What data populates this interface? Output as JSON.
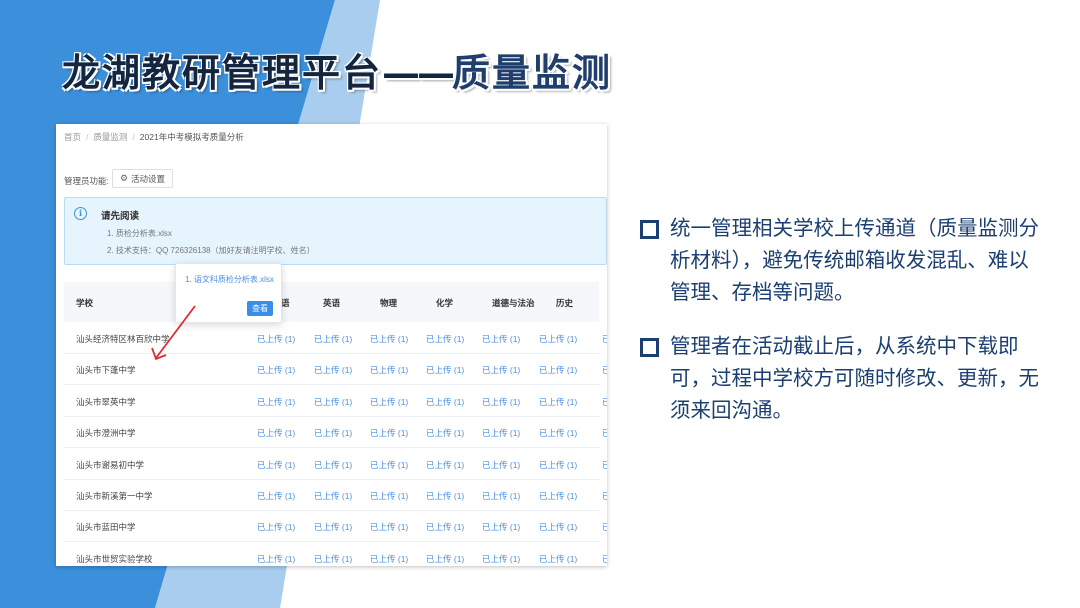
{
  "slide": {
    "title_main": "龙湖教研管理平台",
    "title_dash": "——",
    "title_sub": "质量监测"
  },
  "colors": {
    "accent_blue": "#3b8fdb",
    "light_blue": "#a8cdee",
    "bullet_text": "#1b3f73",
    "link_blue": "#4a90e2"
  },
  "screenshot": {
    "breadcrumb": [
      "首页",
      "质量监测",
      "2021年中考模拟考质量分析"
    ],
    "admin_label": "管理员功能:",
    "activity_button": "活动设置",
    "activity_icon": "gear-icon",
    "notice": {
      "icon": "info-icon",
      "title": "请先阅读",
      "lines": [
        "1. 质检分析表.xlsx",
        "2. 技术支持：QQ 726326138（加好友请注明学校、姓名）"
      ]
    },
    "table": {
      "headers": [
        "学校",
        "语",
        "数",
        "英语",
        "物理",
        "化学",
        "道德与法治",
        "历史"
      ],
      "status_label": "已上传 (1)",
      "rows": [
        "汕头经济特区林百欣中学",
        "汕头市下蓬中学",
        "汕头市翠英中学",
        "汕头市澄洲中学",
        "汕头市谢易初中学",
        "汕头市新溪第一中学",
        "汕头市蓝田中学",
        "汕头市世贸实验学校"
      ]
    },
    "popover": {
      "file_link": "1. 语文科质检分析表.xlsx",
      "view_button": "查看"
    }
  },
  "bullets": [
    "统一管理相关学校上传通道（质量监测分析材料），避免传统邮箱收发混乱、难以管理、存档等问题。",
    "管理者在活动截止后，从系统中下载即可，过程中学校方可随时修改、更新，无须来回沟通。"
  ]
}
